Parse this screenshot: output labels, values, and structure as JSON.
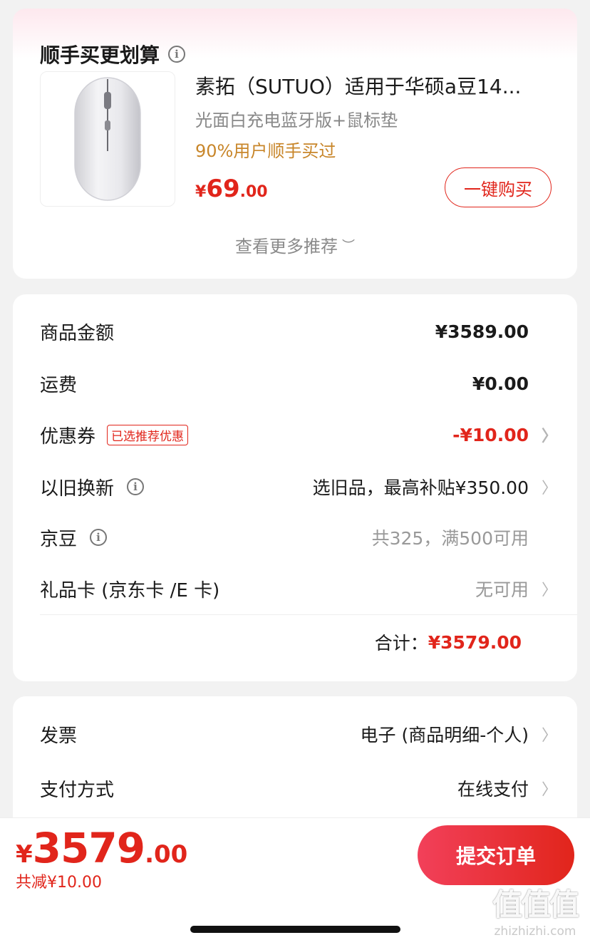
{
  "recommend": {
    "title": "顺手买更划算",
    "info_icon": "info-icon",
    "product": {
      "image_icon": "wireless-mouse-icon",
      "name": "素拓（SUTUO）适用于华硕a豆14...",
      "variant": "光面白充电蓝牙版+鼠标垫",
      "social_proof": "90%用户顺手买过",
      "price_currency": "¥",
      "price_int": "69",
      "price_dec": ".00",
      "buy_button": "一键购买"
    },
    "see_more": "查看更多推荐"
  },
  "summary": {
    "goods_amount": {
      "label": "商品金额",
      "value": "¥3589.00"
    },
    "shipping": {
      "label": "运费",
      "value": "¥0.00"
    },
    "coupon": {
      "label": "优惠券",
      "tag": "已选推荐优惠",
      "value": "-¥10.00"
    },
    "trade_in": {
      "label": "以旧换新",
      "value": "选旧品，最高补贴¥350.00"
    },
    "jd_beans": {
      "label": "京豆",
      "value": "共325，满500可用"
    },
    "gift_card": {
      "label": "礼品卡 (京东卡 /E 卡)",
      "value": "无可用"
    },
    "total_label": "合计：",
    "total_value": "¥3579.00"
  },
  "payment": {
    "invoice": {
      "label": "发票",
      "value": "电子 (商品明细-个人)"
    },
    "method": {
      "label": "支付方式",
      "value": "在线支付"
    }
  },
  "bottom_bar": {
    "currency": "¥",
    "total_int": "3579",
    "total_dec": ".00",
    "saved": "共减¥10.00",
    "submit": "提交订单"
  },
  "watermark": {
    "big": "值值值",
    "small": "zhizhizhi.com"
  },
  "colors": {
    "accent": "#e1251b",
    "social_proof": "#c8862a",
    "background": "#f2f2f2"
  }
}
